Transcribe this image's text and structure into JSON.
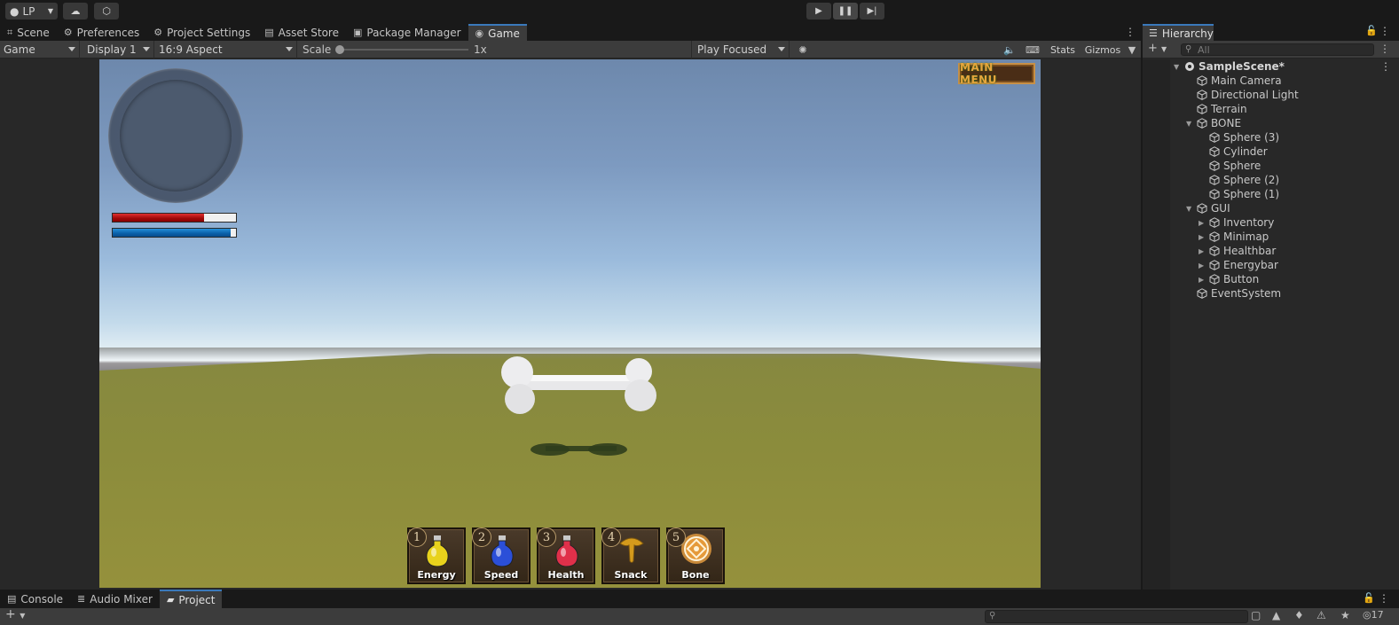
{
  "toolbar": {
    "account_label": "LP",
    "play_icons": [
      "play-icon",
      "pause-icon",
      "step-icon"
    ]
  },
  "game_panel": {
    "tabs": [
      {
        "label": "Scene",
        "icon": "grid-icon"
      },
      {
        "label": "Preferences",
        "icon": "gear-icon"
      },
      {
        "label": "Project Settings",
        "icon": "gear-icon"
      },
      {
        "label": "Asset Store",
        "icon": "bag-icon"
      },
      {
        "label": "Package Manager",
        "icon": "package-icon"
      },
      {
        "label": "Game",
        "icon": "gamepad-icon",
        "active": true
      }
    ],
    "toolbar": {
      "view_mode": "Game",
      "display": "Display 1",
      "aspect": "16:9 Aspect",
      "scale_label": "Scale",
      "scale_value": "1x",
      "play_mode": "Play Focused",
      "stats_label": "Stats",
      "gizmos_label": "Gizmos"
    }
  },
  "game_ui": {
    "main_menu_label": "MAIN MENU",
    "health_fraction": 0.74,
    "energy_fraction": 0.96,
    "inventory": [
      {
        "num": "1",
        "label": "Energy",
        "color": "#e8d21c"
      },
      {
        "num": "2",
        "label": "Speed",
        "color": "#2b4fd8"
      },
      {
        "num": "3",
        "label": "Health",
        "color": "#e0304a"
      },
      {
        "num": "4",
        "label": "Snack",
        "color": "#d49a1c"
      },
      {
        "num": "5",
        "label": "Bone",
        "color": "#e59a3a"
      }
    ]
  },
  "hierarchy": {
    "title": "Hierarchy",
    "search_placeholder": "All",
    "items": [
      {
        "label": "SampleScene*",
        "depth": 0,
        "arrow": "down",
        "scene": true
      },
      {
        "label": "Main Camera",
        "depth": 1,
        "arrow": "none"
      },
      {
        "label": "Directional Light",
        "depth": 1,
        "arrow": "none"
      },
      {
        "label": "Terrain",
        "depth": 1,
        "arrow": "none"
      },
      {
        "label": "BONE",
        "depth": 1,
        "arrow": "down"
      },
      {
        "label": "Sphere (3)",
        "depth": 2,
        "arrow": "none"
      },
      {
        "label": "Cylinder",
        "depth": 2,
        "arrow": "none"
      },
      {
        "label": "Sphere",
        "depth": 2,
        "arrow": "none"
      },
      {
        "label": "Sphere (2)",
        "depth": 2,
        "arrow": "none"
      },
      {
        "label": "Sphere (1)",
        "depth": 2,
        "arrow": "none"
      },
      {
        "label": "GUI",
        "depth": 1,
        "arrow": "down"
      },
      {
        "label": "Inventory",
        "depth": 2,
        "arrow": "right"
      },
      {
        "label": "Minimap",
        "depth": 2,
        "arrow": "right"
      },
      {
        "label": "Healthbar",
        "depth": 2,
        "arrow": "right"
      },
      {
        "label": "Energybar",
        "depth": 2,
        "arrow": "right"
      },
      {
        "label": "Button",
        "depth": 2,
        "arrow": "right"
      },
      {
        "label": "EventSystem",
        "depth": 1,
        "arrow": "none"
      }
    ]
  },
  "bottom": {
    "tabs": [
      {
        "label": "Console",
        "icon": "console-icon"
      },
      {
        "label": "Audio Mixer",
        "icon": "mixer-icon"
      },
      {
        "label": "Project",
        "icon": "folder-icon",
        "active": true
      }
    ],
    "hidden_count": "17"
  }
}
